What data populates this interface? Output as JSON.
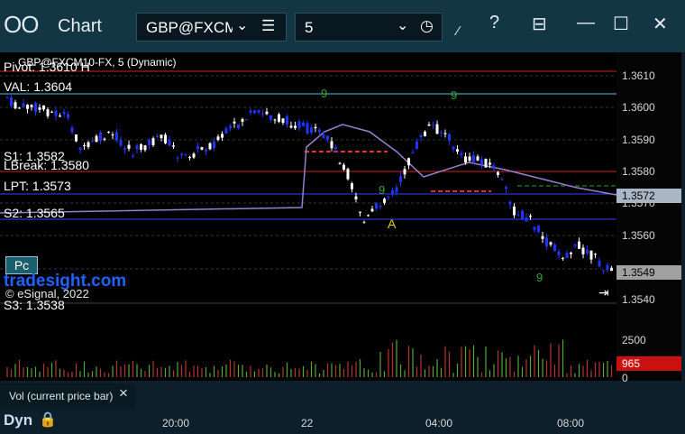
{
  "window": {
    "title": "Chart",
    "app_icon": "chart-app-icon"
  },
  "toolbar": {
    "symbol": "GBP@FXCM",
    "interval": "5",
    "icons": [
      "chevron-down-icon",
      "menu-icon",
      "clock-icon",
      "pencil-icon",
      "help-icon",
      "layout-icon",
      "minimize-icon",
      "maximize-icon",
      "close-icon"
    ]
  },
  "chart": {
    "title": "GBP@FXCM10-FX, 5 (Dynamic)",
    "levels": {
      "pivot": "Pivot: 1.3610 H",
      "val": "VAL: 1.3604",
      "s1": "S1: 1.3582",
      "lbreak": "LBreak: 1.3580",
      "lpt": "LPT: 1.3573",
      "s2": "S2: 1.3565",
      "s3": "S3: 1.3538"
    },
    "price_ticks": [
      "1.3610",
      "1.3600",
      "1.3590",
      "1.3580",
      "1.3570",
      "1.3560",
      "1.3540"
    ],
    "tags": {
      "current": "1.3572",
      "last": "1.3549"
    },
    "pc_button": "Pc",
    "brand": "tradesight.com",
    "copyright": "© eSignal, 2022",
    "signal_letter": "A",
    "colors": {
      "up": "#ffffff",
      "down": "#2233ff",
      "resistance": "#d22020",
      "support": "#3040ff",
      "val": "#4fc3d0",
      "vwap": "#9a7fd0"
    }
  },
  "volume": {
    "label": "Vol (current price bar)",
    "ticks": [
      "2500",
      "0"
    ],
    "current_tag": "965"
  },
  "footer": {
    "mode": "Dyn",
    "times": [
      "20:00",
      "22",
      "04:00",
      "08:00"
    ]
  }
}
